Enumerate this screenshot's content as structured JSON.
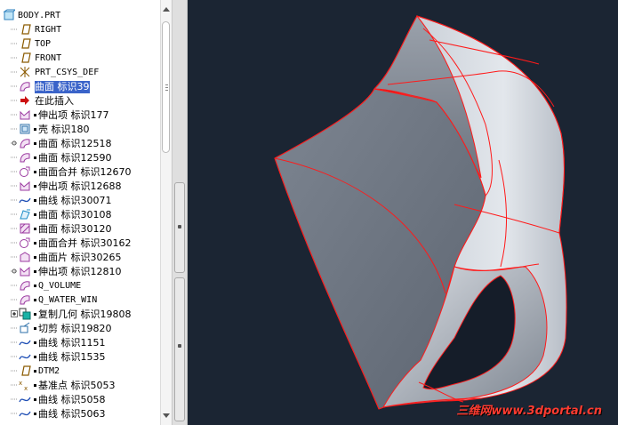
{
  "tree": {
    "root_label": "BODY.PRT",
    "items": [
      {
        "label": "RIGHT",
        "icon": "datum-plane-icon",
        "mono": true,
        "bullet": false,
        "marker": "none"
      },
      {
        "label": "TOP",
        "icon": "datum-plane-icon",
        "mono": true,
        "bullet": false,
        "marker": "none"
      },
      {
        "label": "FRONT",
        "icon": "datum-plane-icon",
        "mono": true,
        "bullet": false,
        "marker": "none"
      },
      {
        "label": "PRT_CSYS_DEF",
        "icon": "coordinate-system-icon",
        "mono": true,
        "bullet": false,
        "marker": "none"
      },
      {
        "label": "曲面 标识39",
        "icon": "surface-icon",
        "mono": false,
        "bullet": false,
        "marker": "none",
        "selected": true
      },
      {
        "label": "在此插入",
        "icon": "insert-here-arrow-icon",
        "mono": false,
        "bullet": false,
        "marker": "none"
      },
      {
        "label": "伸出项 标识177",
        "icon": "protrusion-icon",
        "mono": false,
        "bullet": true,
        "marker": "none"
      },
      {
        "label": "壳 标识180",
        "icon": "shell-icon",
        "mono": false,
        "bullet": true,
        "marker": "none"
      },
      {
        "label": "曲面 标识12518",
        "icon": "surface-icon",
        "mono": false,
        "bullet": true,
        "marker": "branch"
      },
      {
        "label": "曲面 标识12590",
        "icon": "surface-icon",
        "mono": false,
        "bullet": true,
        "marker": "none"
      },
      {
        "label": "曲面合并 标识12670",
        "icon": "surface-merge-icon",
        "mono": false,
        "bullet": true,
        "marker": "none"
      },
      {
        "label": "伸出项 标识12688",
        "icon": "protrusion-icon",
        "mono": false,
        "bullet": true,
        "marker": "none"
      },
      {
        "label": "曲线 标识30071",
        "icon": "curve-icon",
        "mono": false,
        "bullet": true,
        "marker": "none"
      },
      {
        "label": "曲面 标识30108",
        "icon": "boundary-surface-icon",
        "mono": false,
        "bullet": true,
        "marker": "none"
      },
      {
        "label": "曲面 标识30120",
        "icon": "fill-surface-icon",
        "mono": false,
        "bullet": true,
        "marker": "none"
      },
      {
        "label": "曲面合并 标识30162",
        "icon": "surface-merge-icon",
        "mono": false,
        "bullet": true,
        "marker": "none"
      },
      {
        "label": "曲面片 标识30265",
        "icon": "surface-patch-icon",
        "mono": false,
        "bullet": true,
        "marker": "none"
      },
      {
        "label": "伸出项 标识12810",
        "icon": "protrusion-icon",
        "mono": false,
        "bullet": true,
        "marker": "branch"
      },
      {
        "label": "Q_VOLUME",
        "icon": "surface-icon",
        "mono": true,
        "bullet": true,
        "marker": "none"
      },
      {
        "label": "Q_WATER_WIN",
        "icon": "surface-icon",
        "mono": true,
        "bullet": true,
        "marker": "none"
      },
      {
        "label": "复制几何 标识19808",
        "icon": "copy-geometry-icon",
        "mono": false,
        "bullet": true,
        "marker": "expand"
      },
      {
        "label": "切剪 标识19820",
        "icon": "cut-icon",
        "mono": false,
        "bullet": true,
        "marker": "none"
      },
      {
        "label": "曲线 标识1151",
        "icon": "curve-icon",
        "mono": false,
        "bullet": true,
        "marker": "none"
      },
      {
        "label": "曲线 标识1535",
        "icon": "curve-icon",
        "mono": false,
        "bullet": true,
        "marker": "none"
      },
      {
        "label": "DTM2",
        "icon": "datum-plane-icon",
        "mono": true,
        "bullet": true,
        "marker": "none"
      },
      {
        "label": "基准点 标识5053",
        "icon": "datum-point-icon",
        "mono": false,
        "bullet": true,
        "marker": "none"
      },
      {
        "label": "曲线 标识5058",
        "icon": "curve-icon",
        "mono": false,
        "bullet": true,
        "marker": "none"
      },
      {
        "label": "曲线 标识5063",
        "icon": "curve-icon",
        "mono": false,
        "bullet": true,
        "marker": "none"
      }
    ]
  },
  "viewport": {
    "watermark": "三维网www.3dportal.cn",
    "colors": {
      "background": "#1b2533",
      "surface": "#8a919c",
      "surface_light": "#d6dbe2",
      "edge": "#ff1a1a"
    }
  }
}
